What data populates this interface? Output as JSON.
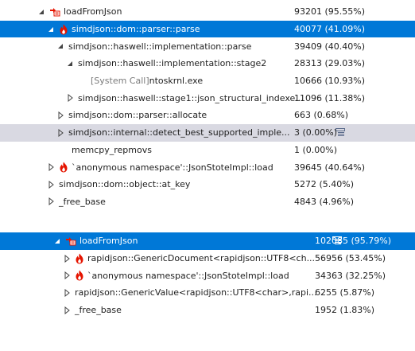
{
  "tree1": {
    "rows": [
      {
        "name": "loadFromJson",
        "value": "93201 (95.55%)",
        "indent": 46,
        "toggle": "expanded",
        "icon": "hotpath",
        "state": ""
      },
      {
        "name": "simdjson::dom::parser::parse",
        "value": "40077 (41.09%)",
        "indent": 58,
        "toggle": "expanded",
        "icon": "flame",
        "state": "selected"
      },
      {
        "name": "simdjson::haswell::implementation::parse",
        "value": "39409 (40.40%)",
        "indent": 70,
        "toggle": "expanded",
        "icon": "",
        "state": ""
      },
      {
        "name": "simdjson::haswell::implementation::stage2",
        "value": "28313 (29.03%)",
        "indent": 82,
        "toggle": "expanded",
        "icon": "",
        "state": ""
      },
      {
        "name": "[System Call] ntoskrnl.exe",
        "value": "10666 (10.93%)",
        "indent": 98,
        "toggle": "none",
        "icon": "",
        "state": "",
        "system": true,
        "system_prefix": "[System Call]",
        "system_rest": " ntoskrnl.exe"
      },
      {
        "name": "simdjson::haswell::stage1::json_structural_indexe...",
        "value": "11096 (11.38%)",
        "indent": 82,
        "toggle": "collapsed",
        "icon": "",
        "state": ""
      },
      {
        "name": "simdjson::dom::parser::allocate",
        "value": "663 (0.68%)",
        "indent": 70,
        "toggle": "collapsed",
        "icon": "",
        "state": ""
      },
      {
        "name": "simdjson::internal::detect_best_supported_imple...",
        "value": "3 (0.00%)",
        "indent": 70,
        "toggle": "collapsed",
        "icon": "",
        "state": "hover",
        "badge": true
      },
      {
        "name": "memcpy_repmovs",
        "value": "1 (0.00%)",
        "indent": 74,
        "toggle": "none",
        "icon": "",
        "state": ""
      },
      {
        "name": "`anonymous namespace'::JsonStoteImpl::load",
        "value": "39645 (40.64%)",
        "indent": 58,
        "toggle": "collapsed",
        "icon": "flame",
        "state": ""
      },
      {
        "name": "simdjson::dom::object::at_key",
        "value": "5272 (5.40%)",
        "indent": 58,
        "toggle": "collapsed",
        "icon": "",
        "state": ""
      },
      {
        "name": "_free_base",
        "value": "4843 (4.96%)",
        "indent": 58,
        "toggle": "collapsed",
        "icon": "",
        "state": ""
      }
    ]
  },
  "tree2": {
    "rows": [
      {
        "name": "loadFromJson",
        "value": "102085 (95.79%)",
        "indent": 66,
        "toggle": "expanded",
        "icon": "hotpath",
        "state": "selected",
        "badge": true
      },
      {
        "name": "rapidjson::GenericDocument<rapidjson::UTF8<ch...",
        "value": "56956 (53.45%)",
        "indent": 78,
        "toggle": "collapsed",
        "icon": "flame",
        "state": ""
      },
      {
        "name": "`anonymous namespace'::JsonStoteImpl::load",
        "value": "34363 (32.25%)",
        "indent": 78,
        "toggle": "collapsed",
        "icon": "flame",
        "state": ""
      },
      {
        "name": "rapidjson::GenericValue<rapidjson::UTF8<char>,rapi...",
        "value": "6255 (5.87%)",
        "indent": 78,
        "toggle": "collapsed",
        "icon": "",
        "state": ""
      },
      {
        "name": "_free_base",
        "value": "1952 (1.83%)",
        "indent": 78,
        "toggle": "collapsed",
        "icon": "",
        "state": ""
      }
    ]
  },
  "icons": {
    "expanded": "triangle-expanded-icon",
    "collapsed": "triangle-collapsed-icon",
    "flame": "flame-icon",
    "hotpath": "hot-path-icon",
    "badge": "hot-path-badge-icon"
  },
  "colors": {
    "selected_bg": "#0078d7",
    "hover_bg": "#d9d9e2",
    "flame_red": "#e51400",
    "text": "#1e1e1e",
    "system_text": "#7a7a7a"
  }
}
